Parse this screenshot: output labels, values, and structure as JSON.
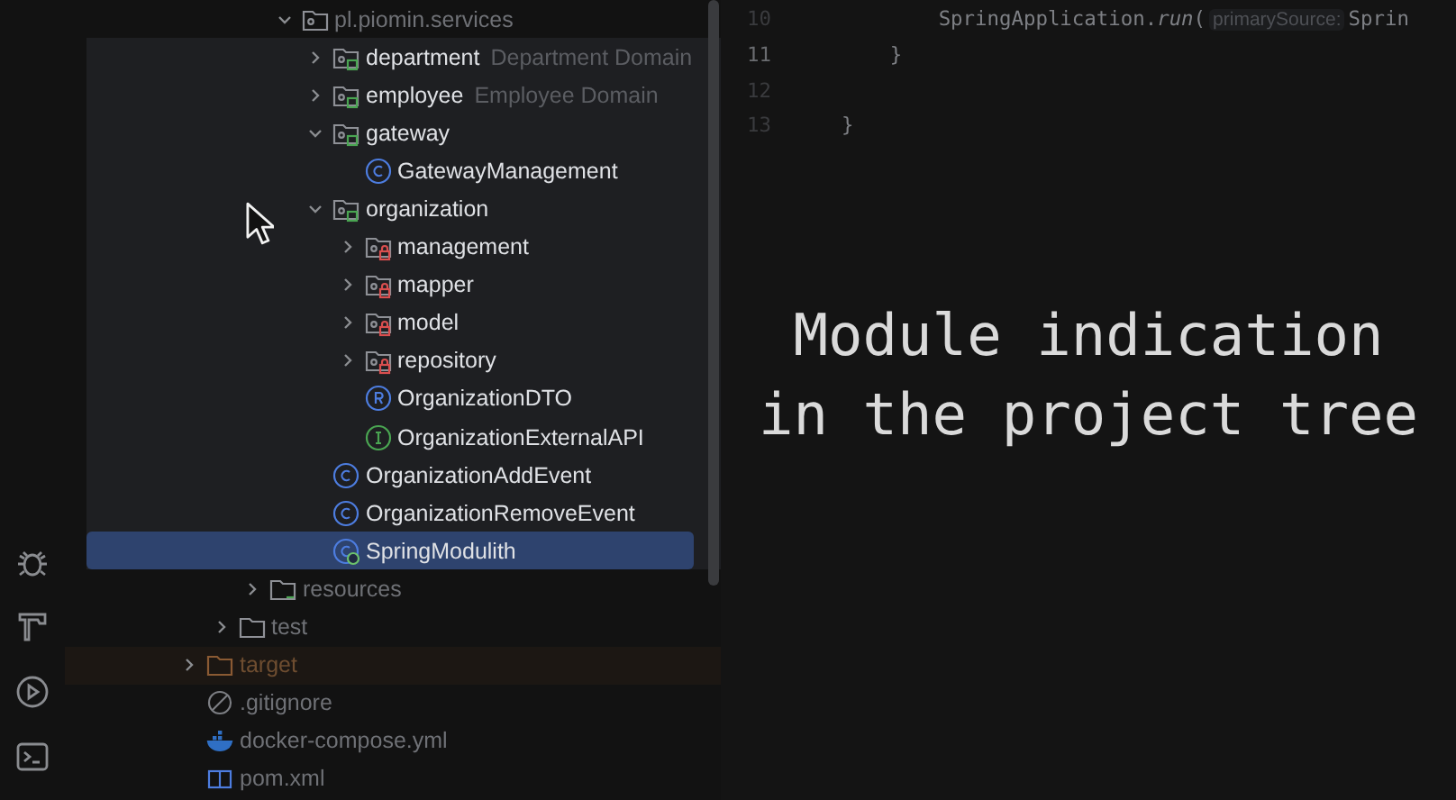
{
  "toolbar": [
    {
      "kind": "debug"
    },
    {
      "kind": "build"
    },
    {
      "kind": "run"
    },
    {
      "kind": "terminal"
    }
  ],
  "project_tree": [
    {
      "label": "pl.piomin.services",
      "kind": "package",
      "expanded": true,
      "focused": false,
      "selected": false,
      "children": [
        {
          "label": "department",
          "hint": "Department Domain",
          "kind": "module",
          "expanded": false,
          "focused": true,
          "selected": false
        },
        {
          "label": "employee",
          "hint": "Employee Domain",
          "kind": "module",
          "expanded": false,
          "focused": true,
          "selected": false
        },
        {
          "label": "gateway",
          "kind": "module",
          "expanded": true,
          "focused": true,
          "selected": false,
          "children": [
            {
              "label": "GatewayManagement",
              "kind": "class",
              "focused": true,
              "selected": false
            }
          ]
        },
        {
          "label": "organization",
          "kind": "module",
          "expanded": true,
          "focused": true,
          "selected": false,
          "children": [
            {
              "label": "management",
              "kind": "internal",
              "expanded": false,
              "focused": true,
              "selected": false
            },
            {
              "label": "mapper",
              "kind": "internal",
              "expanded": false,
              "focused": true,
              "selected": false
            },
            {
              "label": "model",
              "kind": "internal",
              "expanded": false,
              "focused": true,
              "selected": false
            },
            {
              "label": "repository",
              "kind": "internal",
              "expanded": false,
              "focused": true,
              "selected": false
            },
            {
              "label": "OrganizationDTO",
              "kind": "record",
              "focused": true,
              "selected": false
            },
            {
              "label": "OrganizationExternalAPI",
              "kind": "interface",
              "focused": true,
              "selected": false
            }
          ]
        },
        {
          "label": "OrganizationAddEvent",
          "kind": "class",
          "focused": true,
          "selected": false
        },
        {
          "label": "OrganizationRemoveEvent",
          "kind": "class",
          "focused": true,
          "selected": false
        },
        {
          "label": "SpringModulith",
          "kind": "application",
          "focused": true,
          "selected": true
        }
      ]
    },
    {
      "label": "resources",
      "kind": "resources",
      "expanded": false,
      "focused": false,
      "selected": false
    },
    {
      "label": "test",
      "kind": "folder",
      "expanded": false,
      "focused": false,
      "selected": false
    },
    {
      "label": "target",
      "kind": "excluded",
      "expanded": false,
      "focused": false,
      "selected": false
    },
    {
      "label": ".gitignore",
      "kind": "ignore",
      "focused": false,
      "selected": false
    },
    {
      "label": "docker-compose.yml",
      "kind": "docker",
      "focused": false,
      "selected": false
    },
    {
      "label": "pom.xml",
      "kind": "maven",
      "focused": false,
      "selected": false
    }
  ],
  "editor": {
    "lines": [
      {
        "number": "10",
        "current": false,
        "parts": [
          {
            "kind": "code",
            "text": "            SpringApplication."
          },
          {
            "kind": "italic",
            "text": "run"
          },
          {
            "kind": "code",
            "text": "("
          },
          {
            "kind": "hint",
            "text": "primarySource:"
          },
          {
            "kind": "code",
            "text": "Sprin"
          }
        ]
      },
      {
        "number": "11",
        "current": true,
        "parts": [
          {
            "kind": "code",
            "text": "        }"
          }
        ]
      },
      {
        "number": "12",
        "current": false
      },
      {
        "number": "13",
        "current": false,
        "parts": [
          {
            "kind": "code",
            "text": "    }"
          }
        ]
      }
    ],
    "caption": [
      "Module indication",
      "in the project tree"
    ]
  }
}
